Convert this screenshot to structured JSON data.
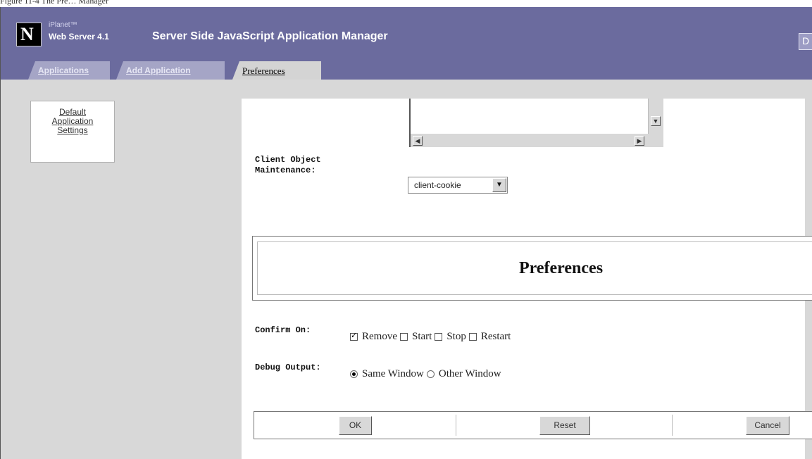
{
  "figure_caption": "Figure 11-4 The Pre… Manager",
  "header": {
    "brand_top": "iPlanet™",
    "brand_main": "Web Server 4.1",
    "title": "Server Side JavaScript Application Manager",
    "logo_glyph": "N",
    "right_button_label": "D"
  },
  "tabs": [
    {
      "label": "Applications",
      "active": false
    },
    {
      "label": "Add Application",
      "active": false
    },
    {
      "label": "Preferences",
      "active": true
    }
  ],
  "leftnav": {
    "items": [
      {
        "label_lines": [
          "Default",
          "Application",
          "Settings"
        ]
      }
    ]
  },
  "form": {
    "client_object_label_line1": "Client Object",
    "client_object_label_line2": "Maintenance:",
    "client_object_value": "client-cookie",
    "section_title": "Preferences",
    "confirm_label": "Confirm On:",
    "confirm_options": [
      {
        "label": "Remove",
        "checked": true
      },
      {
        "label": "Start",
        "checked": false
      },
      {
        "label": "Stop",
        "checked": false
      },
      {
        "label": "Restart",
        "checked": false
      }
    ],
    "debug_label": "Debug Output:",
    "debug_options": [
      {
        "label": "Same Window",
        "selected": true
      },
      {
        "label": "Other Window",
        "selected": false
      }
    ]
  },
  "buttons": {
    "ok": "OK",
    "reset": "Reset",
    "cancel": "Cancel"
  },
  "colors": {
    "header_bg": "#6b6b9e",
    "panel_bg": "#d8d8d8",
    "tab_inactive": "#a5a5c6"
  }
}
